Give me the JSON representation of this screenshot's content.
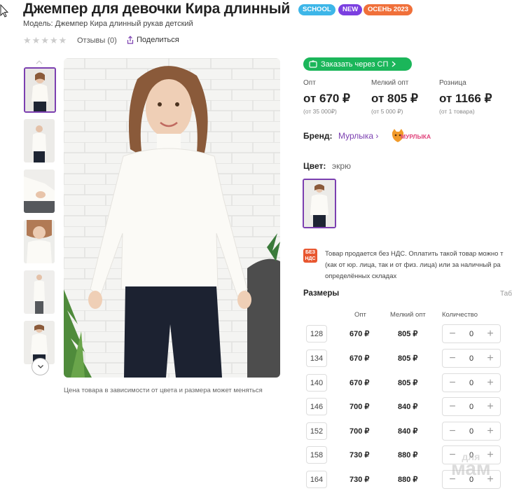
{
  "product": {
    "title": "Джемпер для девочки Кира длинный",
    "model_label": "Модель: Джемпер Кира длинный рукав детский",
    "badges": [
      {
        "label": "SCHOOL",
        "color": "#3db6e8"
      },
      {
        "label": "NEW",
        "color": "#7b3fe0"
      },
      {
        "label": "ОСЕНЬ 2023",
        "color": "#f0703a"
      }
    ],
    "rating_stars": 0,
    "reviews_label": "Отзывы (0)",
    "share_label": "Поделиться"
  },
  "gallery": {
    "thumbnail_count": 6,
    "selected_index": 0,
    "caption": "Цена товара в зависимости от цвета и размера может меняться"
  },
  "order": {
    "sp_button_label": "Заказать через СП",
    "price_columns": [
      {
        "label": "Опт",
        "price": "от 670 ₽",
        "sub": "(от 35 000₽)"
      },
      {
        "label": "Мелкий опт",
        "price": "от 805 ₽",
        "sub": "(от 5 000 ₽)"
      },
      {
        "label": "Розница",
        "price": "от 1166 ₽",
        "sub": "(от 1 товара)"
      }
    ]
  },
  "brand": {
    "label": "Бренд:",
    "name": "Мурлыка",
    "logo_text": "МУРЛЫКА"
  },
  "color": {
    "label": "Цвет:",
    "value": "экрю"
  },
  "nds": {
    "icon_text": "БЕЗ НДС",
    "line1": "Товар продается без НДС. Оплатить такой товар можно т",
    "line2": "(как от юр. лица, так и от физ. лица) или за наличный ра",
    "line3": "определённых складах"
  },
  "sizes": {
    "title": "Размеры",
    "table_link": "Таблица",
    "headers": {
      "opt": "Опт",
      "small_opt": "Мелкий опт",
      "qty": "Количество"
    },
    "rows": [
      {
        "size": "128",
        "opt": "670 ₽",
        "small_opt": "805 ₽",
        "qty": "0"
      },
      {
        "size": "134",
        "opt": "670 ₽",
        "small_opt": "805 ₽",
        "qty": "0"
      },
      {
        "size": "140",
        "opt": "670 ₽",
        "small_opt": "805 ₽",
        "qty": "0"
      },
      {
        "size": "146",
        "opt": "700 ₽",
        "small_opt": "840 ₽",
        "qty": "0"
      },
      {
        "size": "152",
        "opt": "700 ₽",
        "small_opt": "840 ₽",
        "qty": "0"
      },
      {
        "size": "158",
        "opt": "730 ₽",
        "small_opt": "880 ₽",
        "qty": "0"
      },
      {
        "size": "164",
        "opt": "730 ₽",
        "small_opt": "880 ₽",
        "qty": "0"
      }
    ]
  },
  "watermark": {
    "top": "для",
    "bottom": "мам"
  },
  "colors": {
    "accent": "#7b3fb0",
    "green": "#1bb65a",
    "nds": "#e8562f"
  }
}
